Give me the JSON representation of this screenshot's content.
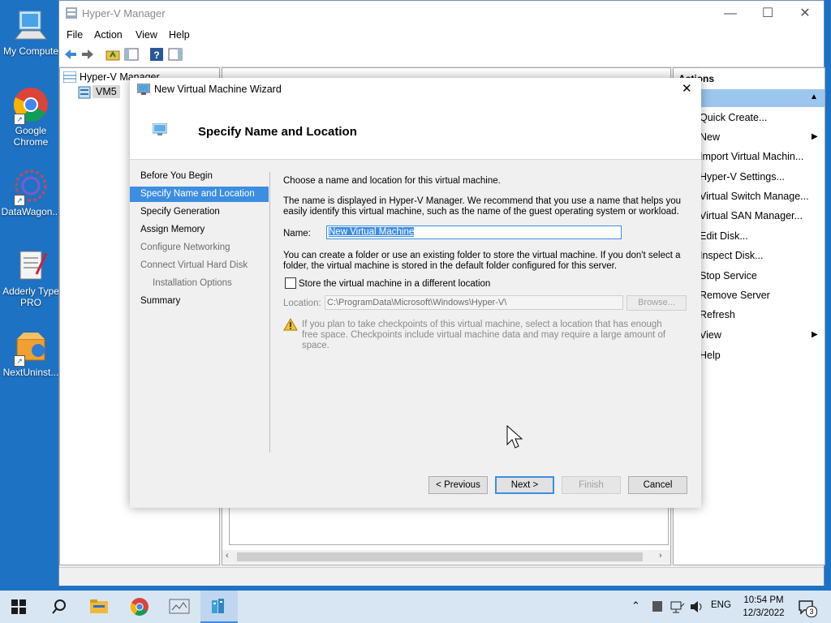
{
  "desktop": {
    "icons": [
      {
        "label": "My Compute",
        "icon": "computer-icon"
      },
      {
        "label": "Google Chrome",
        "icon": "chrome-icon"
      },
      {
        "label": "DataWagon...",
        "icon": "datawagon-icon"
      },
      {
        "label": "Adderly Type PRO",
        "icon": "notepad-icon"
      },
      {
        "label": "NextUninst...",
        "icon": "uninstaller-icon"
      }
    ]
  },
  "main_window": {
    "title": "Hyper-V Manager",
    "menu": [
      "File",
      "Action",
      "View",
      "Help"
    ],
    "tree": {
      "root": "Hyper-V Manager",
      "child": "VM5"
    },
    "actions_header": "Actions",
    "actions": [
      "Quick Create...",
      "New",
      "Import Virtual Machin...",
      "Hyper-V Settings...",
      "Virtual Switch Manage...",
      "Virtual SAN Manager...",
      "Edit Disk...",
      "Inspect Disk...",
      "Stop Service",
      "Remove Server",
      "Refresh",
      "View",
      "Help"
    ]
  },
  "wizard": {
    "title": "New Virtual Machine Wizard",
    "header": "Specify Name and Location",
    "steps": [
      {
        "label": "Before You Begin",
        "state": "normal"
      },
      {
        "label": "Specify Name and Location",
        "state": "active"
      },
      {
        "label": "Specify Generation",
        "state": "normal"
      },
      {
        "label": "Assign Memory",
        "state": "normal"
      },
      {
        "label": "Configure Networking",
        "state": "dim"
      },
      {
        "label": "Connect Virtual Hard Disk",
        "state": "dim"
      },
      {
        "label": "Installation Options",
        "state": "dim"
      },
      {
        "label": "Summary",
        "state": "normal"
      }
    ],
    "intro": "Choose a name and location for this virtual machine.",
    "name_help": "The name is displayed in Hyper-V Manager. We recommend that you use a name that helps you easily identify this virtual machine, such as the name of the guest operating system or workload.",
    "name_label": "Name:",
    "name_value": "New Virtual Machine",
    "folder_help": "You can create a folder or use an existing folder to store the virtual machine. If you don't select a folder, the virtual machine is stored in the default folder configured for this server.",
    "checkbox_label": "Store the virtual machine in a different location",
    "checkbox_checked": false,
    "location_label": "Location:",
    "location_value": "C:\\ProgramData\\Microsoft\\Windows\\Hyper-V\\",
    "browse_label": "Browse...",
    "warning": "If you plan to take checkpoints of this virtual machine, select a location that has enough free space. Checkpoints include virtual machine data and may require a large amount of space.",
    "buttons": {
      "previous": "< Previous",
      "next": "Next >",
      "finish": "Finish",
      "cancel": "Cancel"
    }
  },
  "taskbar": {
    "language": "ENG",
    "time": "10:54 PM",
    "date": "12/3/2022",
    "notifications": "3"
  },
  "colors": {
    "desktop": "#1e72c4",
    "accent": "#3d8ee0",
    "taskbar": "#d8e6f4"
  }
}
